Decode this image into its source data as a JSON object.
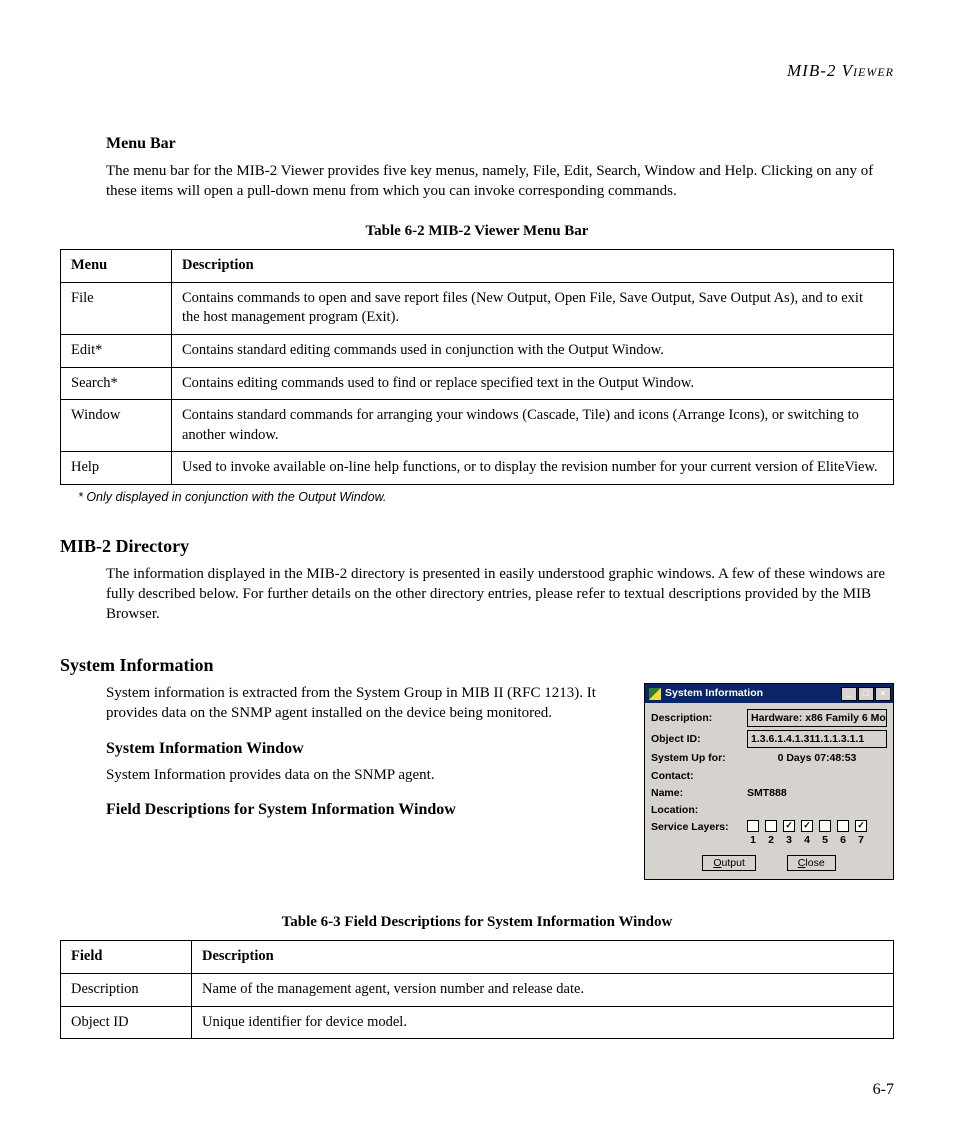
{
  "page_header": "MIB-2 Viewer",
  "menu_bar": {
    "heading": "Menu Bar",
    "paragraph": "The menu bar for the MIB-2 Viewer provides five key menus, namely, File, Edit, Search, Window and Help. Clicking on any of these items will open a pull-down menu from which you can invoke corresponding commands."
  },
  "table62": {
    "caption": "Table 6-2  MIB-2 Viewer Menu Bar",
    "col1": "Menu",
    "col2": "Description",
    "rows": [
      {
        "menu": "File",
        "desc": "Contains commands to open and save report files (New Output, Open File, Save Output, Save Output As), and to exit the host management program (Exit)."
      },
      {
        "menu": "Edit*",
        "desc": "Contains standard editing commands used in conjunction with the Output Window."
      },
      {
        "menu": "Search*",
        "desc": "Contains editing commands used to find or replace specified text in the Output Window."
      },
      {
        "menu": "Window",
        "desc": "Contains standard commands for arranging your windows (Cascade, Tile) and icons (Arrange Icons), or switching to another window."
      },
      {
        "menu": "Help",
        "desc": "Used to invoke available on-line help functions, or to display the revision number for your current version of EliteView."
      }
    ],
    "footnote": "* Only displayed in conjunction with the Output Window."
  },
  "mib2dir": {
    "heading": "MIB-2 Directory",
    "paragraph": "The information displayed in the MIB-2 directory is presented in easily understood graphic windows. A few of these windows are fully described below. For further details on the other directory entries, please refer to textual descriptions provided by the MIB Browser."
  },
  "sysinfo": {
    "heading": "System Information",
    "paragraph": "System information is extracted from the System Group in MIB II (RFC 1213). It provides data on the SNMP agent installed on the device being monitored.",
    "sub1_heading": "System Information Window",
    "sub1_paragraph": "System Information provides data on the SNMP agent.",
    "sub2_heading": "Field Descriptions for System Information Window"
  },
  "sysinfo_window": {
    "title": "System Information",
    "labels": {
      "description": "Description:",
      "object_id": "Object ID:",
      "uptime": "System Up for:",
      "contact": "Contact:",
      "name": "Name:",
      "location": "Location:",
      "layers": "Service Layers:"
    },
    "values": {
      "description": "Hardware: x86 Family 6 Mo",
      "object_id": "1.3.6.1.4.1.311.1.1.3.1.1",
      "uptime": "0  Days  07:48:53",
      "contact": "",
      "name": "SMT888",
      "location": ""
    },
    "layers": [
      {
        "n": "1",
        "checked": false
      },
      {
        "n": "2",
        "checked": false
      },
      {
        "n": "3",
        "checked": true
      },
      {
        "n": "4",
        "checked": true
      },
      {
        "n": "5",
        "checked": false
      },
      {
        "n": "6",
        "checked": false
      },
      {
        "n": "7",
        "checked": true
      }
    ],
    "buttons": {
      "output": "Output",
      "close": "Close"
    }
  },
  "table63": {
    "caption": "Table 6-3  Field Descriptions for System Information Window",
    "col1": "Field",
    "col2": "Description",
    "rows": [
      {
        "field": "Description",
        "desc": "Name of the management agent, version number and release date."
      },
      {
        "field": "Object ID",
        "desc": "Unique identifier for device model."
      }
    ]
  },
  "page_number": "6-7"
}
